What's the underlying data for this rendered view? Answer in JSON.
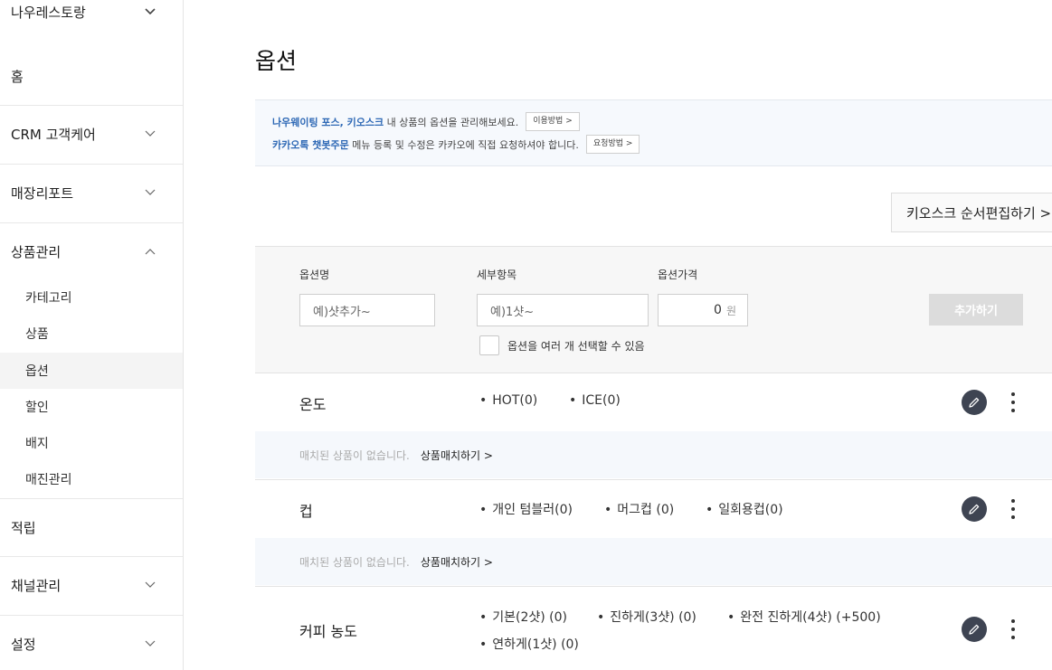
{
  "sidebar": {
    "store_name": "나우레스토랑",
    "items": [
      {
        "label": "홈"
      },
      {
        "label": "CRM 고객케어"
      },
      {
        "label": "매장리포트"
      },
      {
        "label": "상품관리"
      },
      {
        "label": "적립"
      },
      {
        "label": "채널관리"
      },
      {
        "label": "설정"
      }
    ],
    "sub_items": [
      {
        "label": "카테고리"
      },
      {
        "label": "상품"
      },
      {
        "label": "옵션"
      },
      {
        "label": "할인"
      },
      {
        "label": "배지"
      },
      {
        "label": "매진관리"
      }
    ]
  },
  "main": {
    "title": "옵션",
    "notice": {
      "line1_bold": "나우웨이팅 포스, 키오스크",
      "line1_text": " 내 상품의 옵션을 관리해보세요.",
      "line1_button": "이용방법 >",
      "line2_bold": "카카오톡 챗봇주문",
      "line2_text": " 메뉴 등록 및 수정은 카카오에 직접 요청하셔야 합니다.",
      "line2_button": "요청방법 >"
    },
    "kiosk_button": "키오스크 순서편집하기 >",
    "form": {
      "name_label": "옵션명",
      "name_placeholder": "예)샷추가~",
      "detail_label": "세부항목",
      "detail_placeholder": "예)1샷~",
      "price_label": "옵션가격",
      "price_value": "0",
      "price_unit": "원",
      "add_button": "추가하기",
      "multi_select_label": "옵션을 여러 개 선택할 수 있음"
    },
    "options": [
      {
        "name": "온도",
        "items": [
          "HOT(0)",
          "ICE(0)"
        ]
      },
      {
        "name": "컵",
        "items": [
          "개인 텀블러(0)",
          "머그컵 (0)",
          "일회용컵(0)"
        ]
      },
      {
        "name": "커피 농도",
        "items": [
          "기본(2샷) (0)",
          "진하게(3샷) (0)",
          "완전 진하게(4샷) (+500)",
          "연하게(1샷) (0)"
        ]
      }
    ],
    "match": {
      "empty_text": "매치된 상품이 없습니다.",
      "link": "상품매치하기 >"
    }
  }
}
